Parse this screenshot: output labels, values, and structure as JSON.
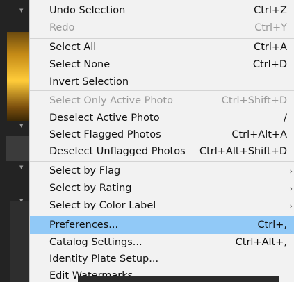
{
  "menu": {
    "items": [
      {
        "label": "Undo Selection",
        "shortcut": "Ctrl+Z",
        "disabled": false
      },
      {
        "label": "Redo",
        "shortcut": "Ctrl+Y",
        "disabled": true
      },
      {
        "label": "Select All",
        "shortcut": "Ctrl+A",
        "disabled": false
      },
      {
        "label": "Select None",
        "shortcut": "Ctrl+D",
        "disabled": false
      },
      {
        "label": "Invert Selection",
        "shortcut": "",
        "disabled": false
      },
      {
        "label": "Select Only Active Photo",
        "shortcut": "Ctrl+Shift+D",
        "disabled": true
      },
      {
        "label": "Deselect Active Photo",
        "shortcut": "/",
        "disabled": false
      },
      {
        "label": "Select Flagged Photos",
        "shortcut": "Ctrl+Alt+A",
        "disabled": false
      },
      {
        "label": "Deselect Unflagged Photos",
        "shortcut": "Ctrl+Alt+Shift+D",
        "disabled": false
      },
      {
        "label": "Select by Flag",
        "shortcut": "",
        "submenu": true
      },
      {
        "label": "Select by Rating",
        "shortcut": "",
        "submenu": true
      },
      {
        "label": "Select by Color Label",
        "shortcut": "",
        "submenu": true
      },
      {
        "label": "Preferences...",
        "shortcut": "Ctrl+,",
        "highlighted": true
      },
      {
        "label": "Catalog Settings...",
        "shortcut": "Ctrl+Alt+,"
      },
      {
        "label": "Identity Plate Setup...",
        "shortcut": ""
      },
      {
        "label": "Edit Watermarks...",
        "shortcut": ""
      }
    ]
  },
  "icons": {
    "submenu_arrow": "chevron-right-icon",
    "arrow_glyph": "›"
  },
  "colors": {
    "menu_bg": "#f2f2f2",
    "highlight": "#91c9f7",
    "disabled_text": "#9a9a9a"
  }
}
